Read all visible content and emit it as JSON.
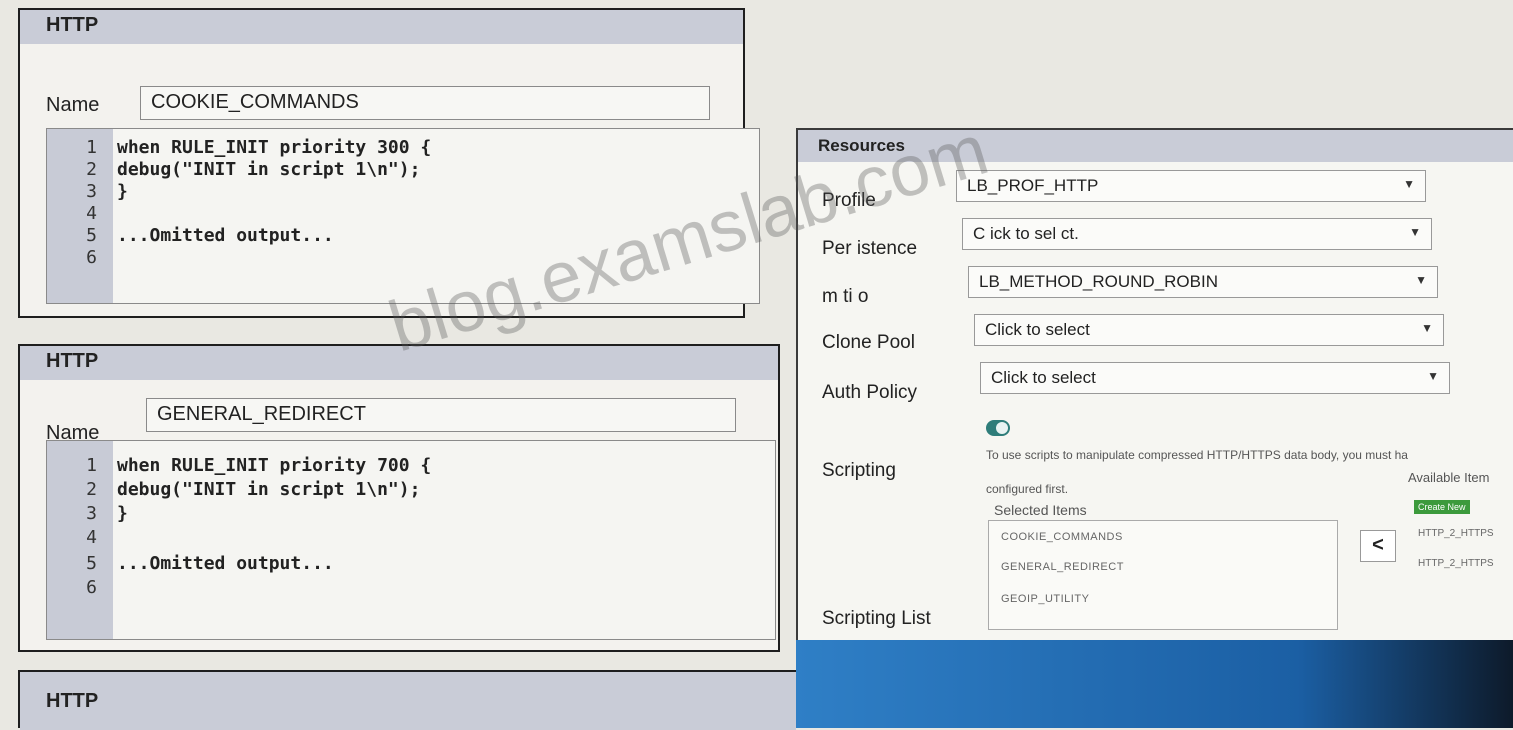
{
  "panels": [
    {
      "header": "HTTP",
      "name_label": "Name",
      "name_value": "COOKIE_COMMANDS",
      "lines": [
        {
          "num": "1",
          "code": "when RULE_INIT priority 300 {"
        },
        {
          "num": "2",
          "code": "debug(\"INIT in script 1\\n\");"
        },
        {
          "num": "3",
          "code": "}"
        },
        {
          "num": "4",
          "code": ""
        },
        {
          "num": "5",
          "code": "...Omitted output..."
        },
        {
          "num": "6",
          "code": ""
        }
      ]
    },
    {
      "header": "HTTP",
      "name_label": "Name",
      "name_value": "GENERAL_REDIRECT",
      "lines": [
        {
          "num": "1",
          "code": "when RULE_INIT priority 700 {"
        },
        {
          "num": "2",
          "code": "debug(\"INIT in script 1\\n\");"
        },
        {
          "num": "3",
          "code": "}"
        },
        {
          "num": "4",
          "code": ""
        },
        {
          "num": "5",
          "code": "...Omitted output..."
        },
        {
          "num": "6",
          "code": ""
        }
      ]
    },
    {
      "header": "HTTP"
    }
  ],
  "resources": {
    "header": "Resources",
    "profile": {
      "label": "Profile",
      "value": "LB_PROF_HTTP"
    },
    "persistence": {
      "label": "Per istence",
      "value": "C ick to sel ct."
    },
    "method": {
      "label": "m ti o",
      "value": "LB_METHOD_ROUND_ROBIN"
    },
    "clone_pool": {
      "label": "Clone Pool",
      "value": "Click to select"
    },
    "auth_policy": {
      "label": "Auth Policy",
      "value": "Click to select"
    },
    "scripting": {
      "label": "Scripting",
      "hint_line1": "To use scripts to manipulate compressed HTTP/HTTPS data body, you must ha",
      "hint_line2": "configured first."
    },
    "scripting_list": {
      "label": "Scripting List",
      "selected_title": "Selected Items",
      "selected_items": [
        "COOKIE_COMMANDS",
        "GENERAL_REDIRECT",
        "GEOIP_UTILITY"
      ],
      "available_title": "Available Item",
      "create_new": "Create New",
      "available_items": [
        "HTTP_2_HTTPS",
        "HTTP_2_HTTPS"
      ],
      "move_button": "<"
    }
  },
  "watermark": "blog.examslab.com",
  "colors": {
    "accent_toggle": "#2e7d7a",
    "header_bg": "#c9ccd7",
    "create_new": "#3c9a3c"
  }
}
